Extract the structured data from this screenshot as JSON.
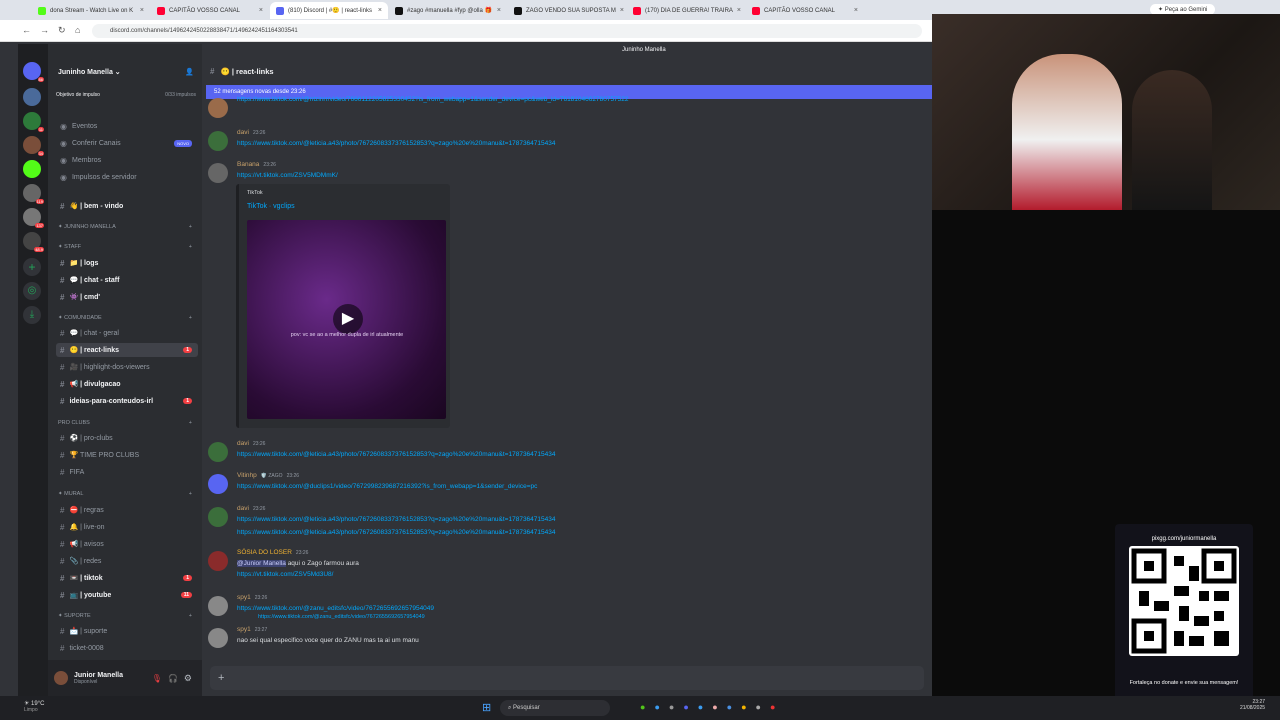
{
  "browser": {
    "tabs": [
      {
        "label": "dona Stream - Watch Live on K",
        "color": "#53fc18"
      },
      {
        "label": "CAPITÃO VOSSO CANAL",
        "color": "#ff0033"
      },
      {
        "label": "(810) Discord | #🙂 | react-links",
        "color": "#5865f2"
      },
      {
        "label": "#zago #manuella #fyp @olla 🎁",
        "color": "#111111"
      },
      {
        "label": "ZAGO VENDO SUA SUPOSTA M",
        "color": "#111111"
      },
      {
        "label": "(170) DIA DE GUERRA! TRAIRA",
        "color": "#ff0033"
      },
      {
        "label": "CAPITÃO VOSSO CANAL",
        "color": "#ff0033"
      }
    ],
    "url": "discord.com/channels/1496242450228838471/1496242451164303541",
    "gemini_label": "Peça ao Gemini"
  },
  "server": {
    "name": "Juninho Manella",
    "boost_goal": "Objetivo de impulso",
    "boost_count": "0/33 impulsos",
    "top_items": [
      {
        "label": "Eventos",
        "icon": "calendar-icon"
      },
      {
        "label": "Conferir Canais",
        "icon": "channels-icon",
        "tag": "NOVO"
      },
      {
        "label": "Membros",
        "icon": "members-icon"
      },
      {
        "label": "Impulsos de servidor",
        "icon": "boost-icon"
      }
    ],
    "server_badges": [
      "86",
      "11",
      "34",
      "119",
      "137",
      "48.9"
    ]
  },
  "sidebar": {
    "welcome": "👋 | bem - vindo",
    "cat_juninho": "✦ JUNINHO MANELLA",
    "cat_staff": "✦ STAFF",
    "staff": [
      "📁 | logs",
      "💬 | chat - staff",
      "👾 | cmd'"
    ],
    "cat_comunidade": "✦ COMUNIDADE",
    "comunidade": [
      {
        "label": "💬 | chat - geral",
        "bold": false
      },
      {
        "label": "😶 | react-links",
        "bold": true,
        "selected": true,
        "badge": "1"
      },
      {
        "label": "🎥 | highlight-dos-viewers",
        "bold": false
      },
      {
        "label": "📢 | divulgacao",
        "bold": true
      },
      {
        "label": "ideias-para-conteudos-irl",
        "bold": true,
        "badge": "1"
      }
    ],
    "cat_pro": "Pro clubs",
    "pro": [
      "⚽ | pro-clubs",
      "🏆 TIME PRO CLUBS",
      "FIFA"
    ],
    "cat_mural": "✦ MURAL",
    "mural": [
      {
        "label": "⛔ | regras",
        "bold": false
      },
      {
        "label": "🔔 | live-on",
        "bold": false
      },
      {
        "label": "📢 | avisos",
        "bold": false
      },
      {
        "label": "📎 | redes",
        "bold": false
      },
      {
        "label": "📼 | tiktok",
        "bold": true,
        "badge": "1"
      },
      {
        "label": "📺 | youtube",
        "bold": true,
        "badge": "11"
      }
    ],
    "cat_suporte": "✦ SUPORTE",
    "suporte": [
      "📩 | suporte",
      "ticket-0008"
    ]
  },
  "user": {
    "name": "Junior Manella",
    "status": "Disponível"
  },
  "channel": {
    "title": "😶 | react-links",
    "streamer_header": "Juninho Manella",
    "new_messages": "52 mensagens novas desde 23:26"
  },
  "messages": [
    {
      "author": "",
      "time": "",
      "link": "https://www.tiktok.com/@ntzinrr/video/7666112205825330452?is_from_webapp=1&sender_device=pc&web_id=7618104662780757522",
      "color": "#9a6b4a"
    },
    {
      "author": "davi",
      "time": "23:26",
      "link": "https://www.tiktok.com/@leticia.a43/photo/7672608337376152853?q=zago%20e%20manu&t=1787364715434",
      "color": "#3b6e3b"
    },
    {
      "author": "Banana",
      "time": "23:26",
      "link": "https://vt.tiktok.com/ZSV5MDMmK/",
      "color": "#666"
    },
    {
      "author": "davi",
      "time": "23:26",
      "link": "https://www.tiktok.com/@leticia.a43/photo/7672608337376152853?q=zago%20e%20manu&t=1787364715434",
      "color": "#3b6e3b"
    },
    {
      "author": "Vitinhp",
      "tag": "🛡️ ZAGO",
      "time": "23:26",
      "link": "https://www.tiktok.com/@duclips1/video/7672998239687216392?is_from_webapp=1&sender_device=pc",
      "color": "#5865f2"
    },
    {
      "author": "davi",
      "time": "23:26",
      "link": "https://www.tiktok.com/@leticia.a43/photo/7672608337376152853?q=zago%20e%20manu&t=1787364715434",
      "link2": "https://www.tiktok.com/@leticia.a43/photo/7672608337376152853?q=zago%20e%20manu&t=1787364715434",
      "color": "#3b6e3b"
    },
    {
      "author": "SÓSIA DO LOSER",
      "time": "23:26",
      "mention": "@Junior Manella",
      "text": "aqui o Zago farmou aura",
      "link": "https://vt.tiktok.com/ZSV5Md3U8/",
      "color": "#8a2b2b"
    },
    {
      "author": "spy1",
      "time": "23:26",
      "link": "https://www.tiktok.com/@zanu_editsfc/video/7672655692657954049",
      "color": "#888"
    },
    {
      "author": "spy1",
      "time": "23:27",
      "reply": "https://www.tiktok.com/@zanu_editsfc/video/7672655692657954049",
      "text": "nao sei qual especifico voce quer do ZANU mas ta ai um manu",
      "color": "#888"
    }
  ],
  "embed": {
    "provider": "TikTok",
    "title": "TikTok · vgclips",
    "caption": "pov: vc se ao a melhor dupla de irl atualmente"
  },
  "qr": {
    "url": "pixgg.com/juniormanella",
    "caption": "Fortaleça no donate e envie sua mensagem!"
  },
  "taskbar": {
    "weather": "19°C",
    "weather_desc": "Limpo",
    "search": "Pesquisar",
    "time": "23:27",
    "date": "21/08/2025"
  },
  "colors": {
    "accent": "#5865f2",
    "link": "#00a8fc",
    "badge": "#f23f43"
  }
}
